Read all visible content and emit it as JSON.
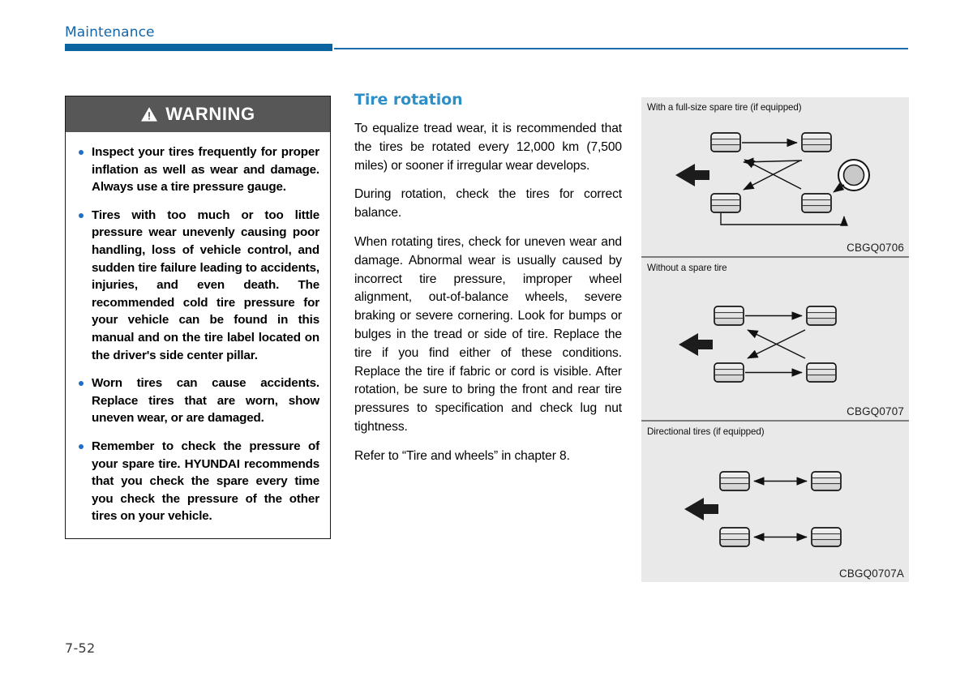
{
  "header": {
    "chapter_title": "Maintenance",
    "rule_color": "#0b639f"
  },
  "warning": {
    "title": "WARNING",
    "icon": "warning-triangle-icon",
    "header_bg": "#575757",
    "bullet_color": "#1f6fc4",
    "items": [
      "Inspect your tires frequently for proper inflation as well as wear and damage. Always use a tire pressure gauge.",
      "Tires with too much or too little pressure wear unevenly causing poor handling, loss of vehicle control, and sudden tire failure leading to accidents, injuries, and even death. The recommended cold tire pressure for your vehicle can be found in this manual and on the tire label located on the driver's side center pillar.",
      "Worn tires can cause accidents. Replace tires that are worn, show uneven wear, or are damaged.",
      "Remember to check the pressure of your spare tire. HYUNDAI recommends that you check the spare every time you check the pressure of the other tires on your vehicle."
    ]
  },
  "main": {
    "heading": "Tire rotation",
    "heading_color": "#2d8fc9",
    "paragraphs": [
      "To equalize tread wear, it is recommended that the tires be rotated every 12,000 km (7,500 miles) or sooner if irregular wear develops.",
      "During rotation, check the tires for correct balance.",
      "When rotating tires, check for uneven wear and damage. Abnormal wear is usually caused by incorrect tire pressure, improper wheel alignment, out-of-balance wheels, severe braking or severe cornering. Look for bumps or bulges in the tread or side of tire. Replace the tire if you find either of these conditions. Replace the tire if fabric or cord is visible. After rotation, be sure to bring the front and rear tire pressures to specification and check lug nut tightness.",
      "Refer to “Tire and wheels” in chapter 8."
    ]
  },
  "figures": [
    {
      "caption": "With a full-size spare tire (if equipped)",
      "code": "CBGQ0706",
      "type": "tire-rotation-diagram-with-spare"
    },
    {
      "caption": "Without a spare tire",
      "code": "CBGQ0707",
      "type": "tire-rotation-diagram-no-spare"
    },
    {
      "caption": "Directional tires (if equipped)",
      "code": "CBGQ0707A",
      "type": "tire-rotation-diagram-directional"
    }
  ],
  "footer": {
    "page_number": "7-52"
  }
}
